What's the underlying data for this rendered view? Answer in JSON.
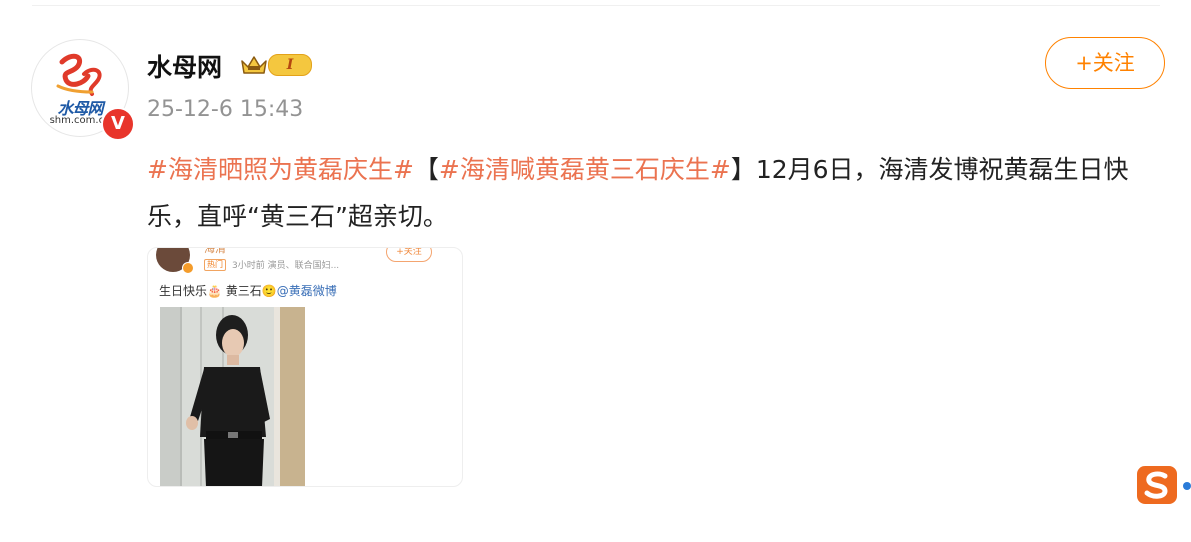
{
  "author": {
    "name": "水母网",
    "vip_level": "I",
    "post_time": "25-12-6 15:43",
    "avatar": {
      "logo_text": "水母网",
      "logo_url": "shm.com.cn",
      "verified_mark": "V"
    }
  },
  "follow_button": {
    "label": "+关注"
  },
  "post": {
    "hashtag1": "#海清晒照为黄磊庆生#",
    "bracket_open": "【",
    "hashtag2": "#海清喊黄磊黄三石庆生#",
    "bracket_close": "】",
    "body_text": "12月6日，海清发博祝黄磊生日快乐，直呼“黄三石”超亲切。"
  },
  "embedded_image": {
    "name": "海清",
    "hot_tag": "热门",
    "meta": "3小时前  演员、联合国妇...",
    "follow_label": "+关注",
    "text": "生日快乐🎂  黄三石🙂",
    "mention": "@黄磊微博"
  },
  "colors": {
    "accent": "#ff8200",
    "hashtag": "#eb7350",
    "timestamp": "#939393",
    "verified": "#e8352b"
  },
  "icons": [
    "crown-icon",
    "verified-icon",
    "sogou-icon"
  ]
}
